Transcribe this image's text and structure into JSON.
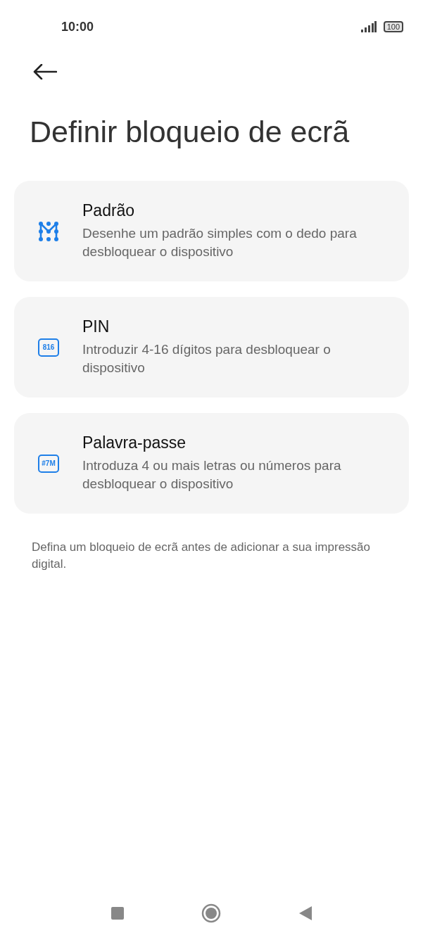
{
  "status_bar": {
    "time": "10:00",
    "battery": "100"
  },
  "title": "Definir bloqueio de ecrã",
  "options": [
    {
      "kind": "pattern",
      "title": "Padrão",
      "description": "Desenhe um padrão simples com o dedo para desbloquear o dispositivo"
    },
    {
      "kind": "code",
      "icon_text": "816",
      "title": "PIN",
      "description": "Introduzir 4-16 dígitos para desbloquear o dispositivo"
    },
    {
      "kind": "code",
      "icon_text": "#7M",
      "title": "Palavra-passe",
      "description": "Introduza 4 ou mais letras ou números para desbloquear o dispositivo"
    }
  ],
  "note": "Defina um bloqueio de ecrã antes de adicionar a sua impressão digital."
}
